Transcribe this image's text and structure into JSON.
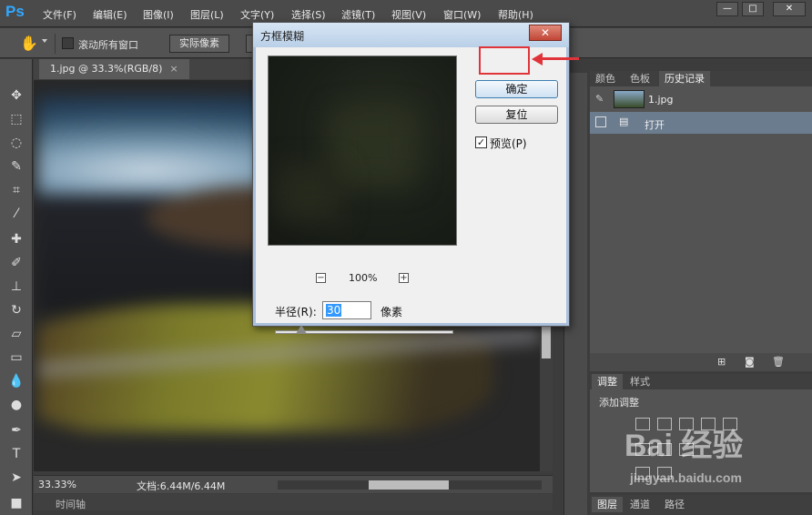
{
  "app": {
    "logo": "Ps"
  },
  "menubar": {
    "items": [
      "文件(F)",
      "编辑(E)",
      "图像(I)",
      "图层(L)",
      "文字(Y)",
      "选择(S)",
      "滤镜(T)",
      "视图(V)",
      "窗口(W)",
      "帮助(H)"
    ]
  },
  "window_controls": {
    "minimize": "—",
    "maximize": "□",
    "close": "✕"
  },
  "options_bar": {
    "tool_icon": "hand-icon",
    "scroll_all_label": "滚动所有窗口",
    "actual_pixels_label": "实际像素"
  },
  "document": {
    "tab_title": "1.jpg @ 33.3%(RGB/8)",
    "tab_close": "×",
    "zoom": "33.33%",
    "doc_info": "文档:6.44M/6.44M",
    "timeline_label": "时间轴"
  },
  "dialog": {
    "title": "方框模糊",
    "close": "✕",
    "ok_label": "确定",
    "reset_label": "复位",
    "preview_check": "✓",
    "preview_label": "预览(P)",
    "zoom_out": "−",
    "zoom_in": "+",
    "zoom_percent": "100%",
    "radius_label": "半径(R):",
    "radius_value": "30",
    "radius_unit": "像素",
    "radius_level": 0.15
  },
  "history_panel": {
    "tabs": [
      "颜色",
      "色板",
      "历史记录"
    ],
    "active_tab": "历史记录",
    "snapshot_label": "1.jpg",
    "states": [
      "打开"
    ]
  },
  "adjustments_panel": {
    "tabs": [
      "调整",
      "样式"
    ],
    "title": "添加调整"
  },
  "layers_panel": {
    "tabs": [
      "图层",
      "通道",
      "路径"
    ]
  },
  "annotation": {
    "color": "#e0343a"
  },
  "watermark": {
    "logo": "Bai 经验",
    "url": "jingyan.baidu.com"
  }
}
